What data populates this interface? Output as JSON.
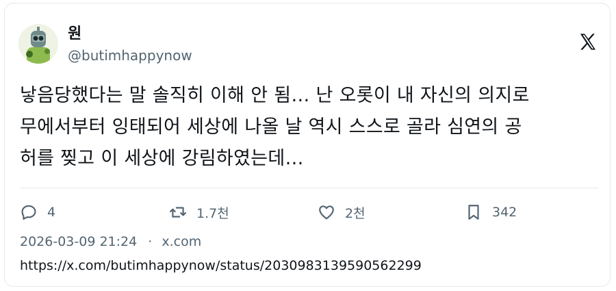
{
  "author": {
    "name": "원",
    "handle": "@butimhappynow"
  },
  "tweet": {
    "text_lines": [
      "낳음당했다는 말 솔직히 이해 안 됨… 난 오롯이 내 자신의 의지로",
      "무에서부터 잉태되어 세상에 나올 날 역시 스스로 골라 심연의 공",
      "허를 찢고 이 세상에 강림하였는데…"
    ]
  },
  "actions": {
    "replies": "4",
    "retweets": "1.7천",
    "likes": "2천",
    "bookmarks": "342"
  },
  "meta": {
    "timestamp": "2026-03-09 21:24",
    "separator": "·",
    "source": "x.com",
    "url": "https://x.com/butimhappynow/status/2030983139590562299"
  },
  "icons": {
    "brand": "x-logo-icon",
    "reply": "reply-icon",
    "retweet": "retweet-icon",
    "like": "heart-icon",
    "bookmark": "bookmark-icon"
  },
  "colors": {
    "text": "#0f1419",
    "secondary": "#536471",
    "border": "#e4e7ea"
  }
}
